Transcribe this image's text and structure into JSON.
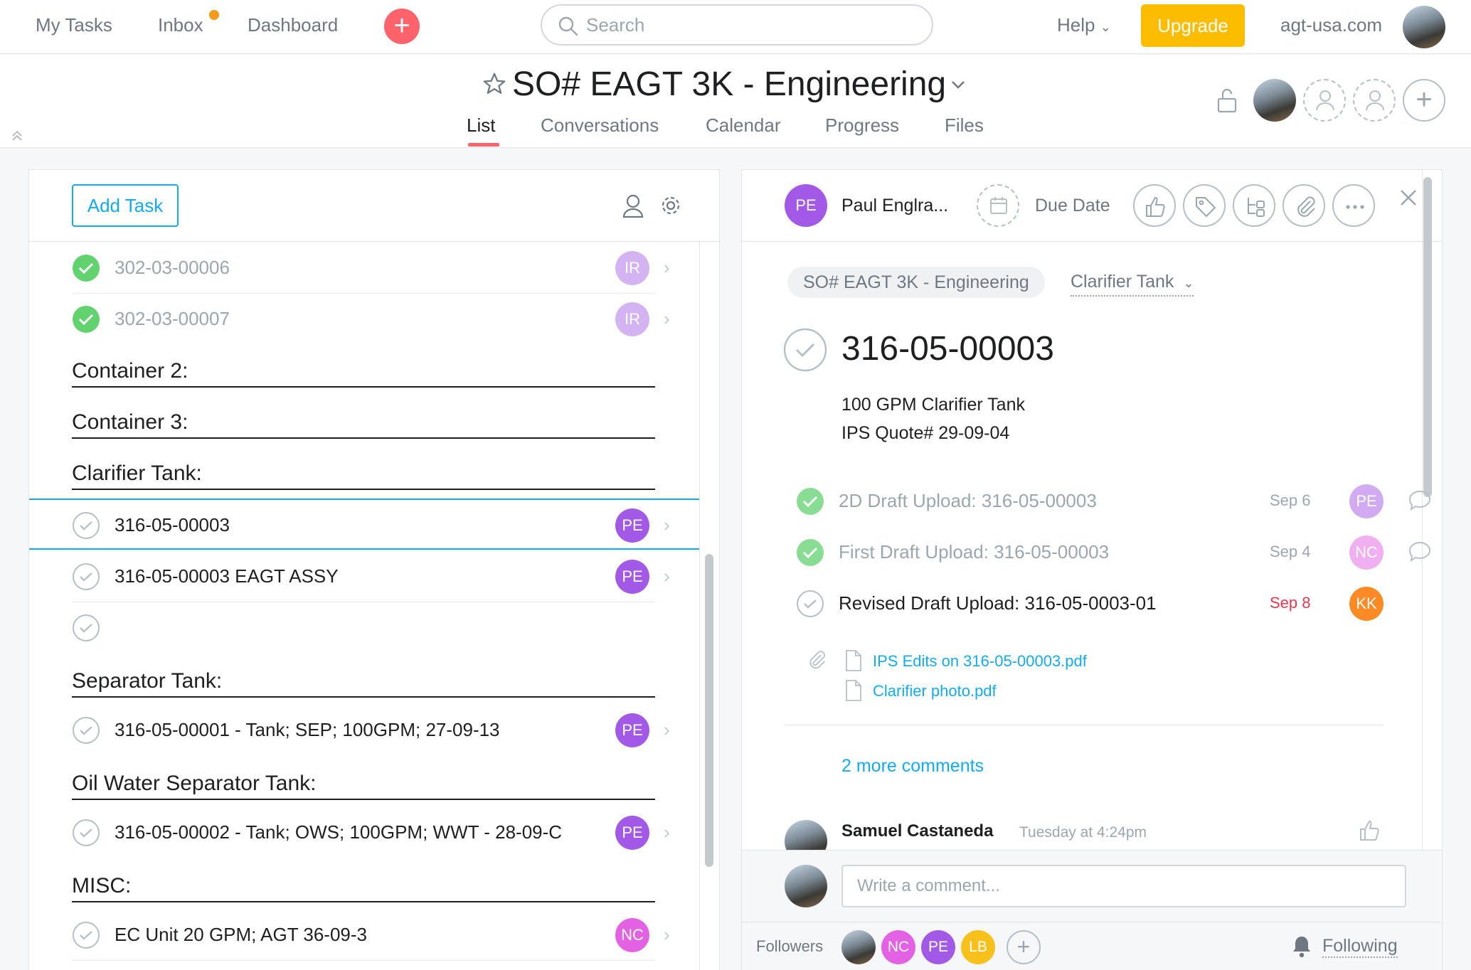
{
  "topbar": {
    "my_tasks": "My Tasks",
    "inbox": "Inbox",
    "dashboard": "Dashboard",
    "search_placeholder": "Search",
    "help": "Help",
    "upgrade": "Upgrade",
    "domain": "agt-usa.com"
  },
  "project": {
    "title": "SO# EAGT 3K - Engineering",
    "tabs": [
      "List",
      "Conversations",
      "Calendar",
      "Progress",
      "Files"
    ],
    "active_tab": "List"
  },
  "left": {
    "add_task": "Add Task",
    "rows": [
      {
        "label": "302-03-00006",
        "assignee": "IR",
        "done": true
      },
      {
        "label": "302-03-00007",
        "assignee": "IR",
        "done": true
      },
      {
        "section": "Container 2:"
      },
      {
        "section": "Container 3:"
      },
      {
        "section": "Clarifier Tank:"
      },
      {
        "label": "316-05-00003",
        "assignee": "PE",
        "done": false,
        "selected": true
      },
      {
        "label": "316-05-00003 EAGT ASSY",
        "assignee": "PE",
        "done": false
      },
      {
        "label": "",
        "assignee": "",
        "done": false
      },
      {
        "section": "Separator Tank:"
      },
      {
        "label": "316-05-00001 - Tank; SEP; 100GPM; 27-09-13",
        "assignee": "PE",
        "done": false
      },
      {
        "section": "Oil Water Separator Tank:"
      },
      {
        "label": "316-05-00002 - Tank; OWS; 100GPM; WWT - 28-09-C",
        "assignee": "PE",
        "done": false
      },
      {
        "section": "MISC:"
      },
      {
        "label": "EC Unit 20 GPM; AGT 36-09-3",
        "assignee": "NC",
        "done": false
      }
    ]
  },
  "detail": {
    "assignee_initials": "PE",
    "assignee_name": "Paul Englra...",
    "due_date": "Due Date",
    "project_pill": "SO# EAGT 3K - Engineering",
    "section_pill": "Clarifier Tank",
    "task_title": "316-05-00003",
    "description_line1": "100 GPM Clarifier Tank",
    "description_line2": "IPS Quote# 29-09-04",
    "subtasks": [
      {
        "label": "2D Draft Upload: 316-05-00003",
        "date": "Sep 6",
        "assignee": "PE",
        "done": true,
        "overdue": false
      },
      {
        "label": "First Draft Upload: 316-05-00003",
        "date": "Sep 4",
        "assignee": "NC",
        "done": true,
        "overdue": false
      },
      {
        "label": "Revised Draft Upload: 316-05-0003-01",
        "date": "Sep 8",
        "assignee": "KK",
        "done": false,
        "overdue": true
      }
    ],
    "attachments": [
      "IPS Edits on 316-05-00003.pdf",
      "Clarifier photo.pdf"
    ],
    "more_comments": "2 more comments",
    "comment_author": "Samuel Castaneda",
    "comment_time": "Tuesday at 4:24pm",
    "comment_placeholder": "Write a comment...",
    "followers_label": "Followers",
    "followers": [
      "NC",
      "PE",
      "LB"
    ],
    "following": "Following"
  },
  "colors": {
    "pe": "#a259e6",
    "ir": "#a259e6",
    "nc": "#e362e3",
    "kk": "#fd8a24",
    "lb": "#f8c01a",
    "accent": "#14aaf5",
    "done_check": "#62d26f",
    "tab_underline": "#fc636b"
  }
}
